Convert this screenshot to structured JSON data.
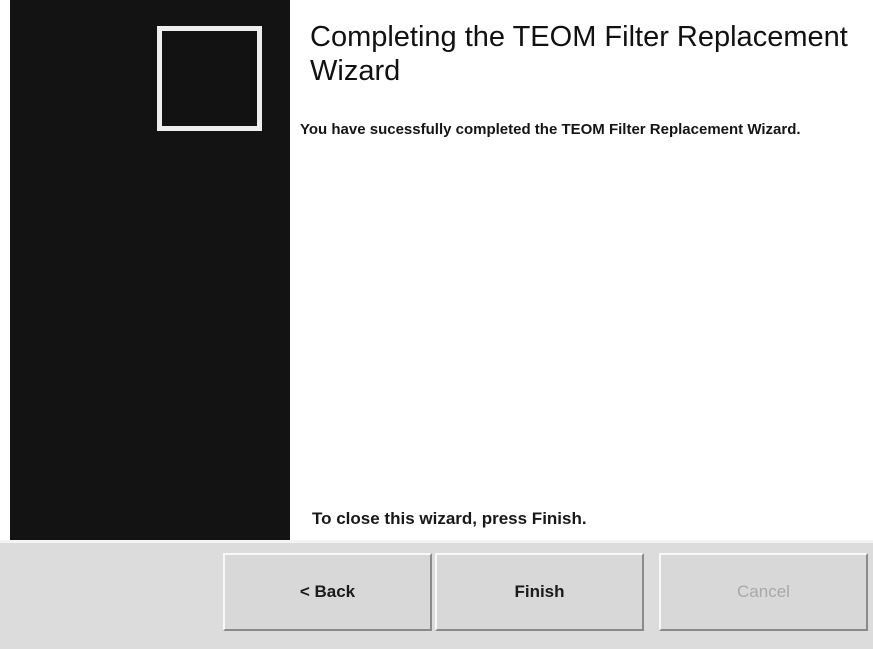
{
  "window": {
    "title": "Completing the TEOM Filter Replacement Wizard"
  },
  "side_panel": {
    "icon": "blank-square-icon",
    "colors": {
      "panel": "#131313",
      "icon_border": "#eeeeee"
    }
  },
  "content": {
    "message": "You have sucessfully completed the TEOM Filter Replacement Wizard.",
    "footer_note": "To close this wizard, press Finish."
  },
  "buttons": {
    "back_label": "< Back",
    "finish_label": "Finish",
    "cancel_label": "Cancel",
    "cancel_enabled": false
  }
}
